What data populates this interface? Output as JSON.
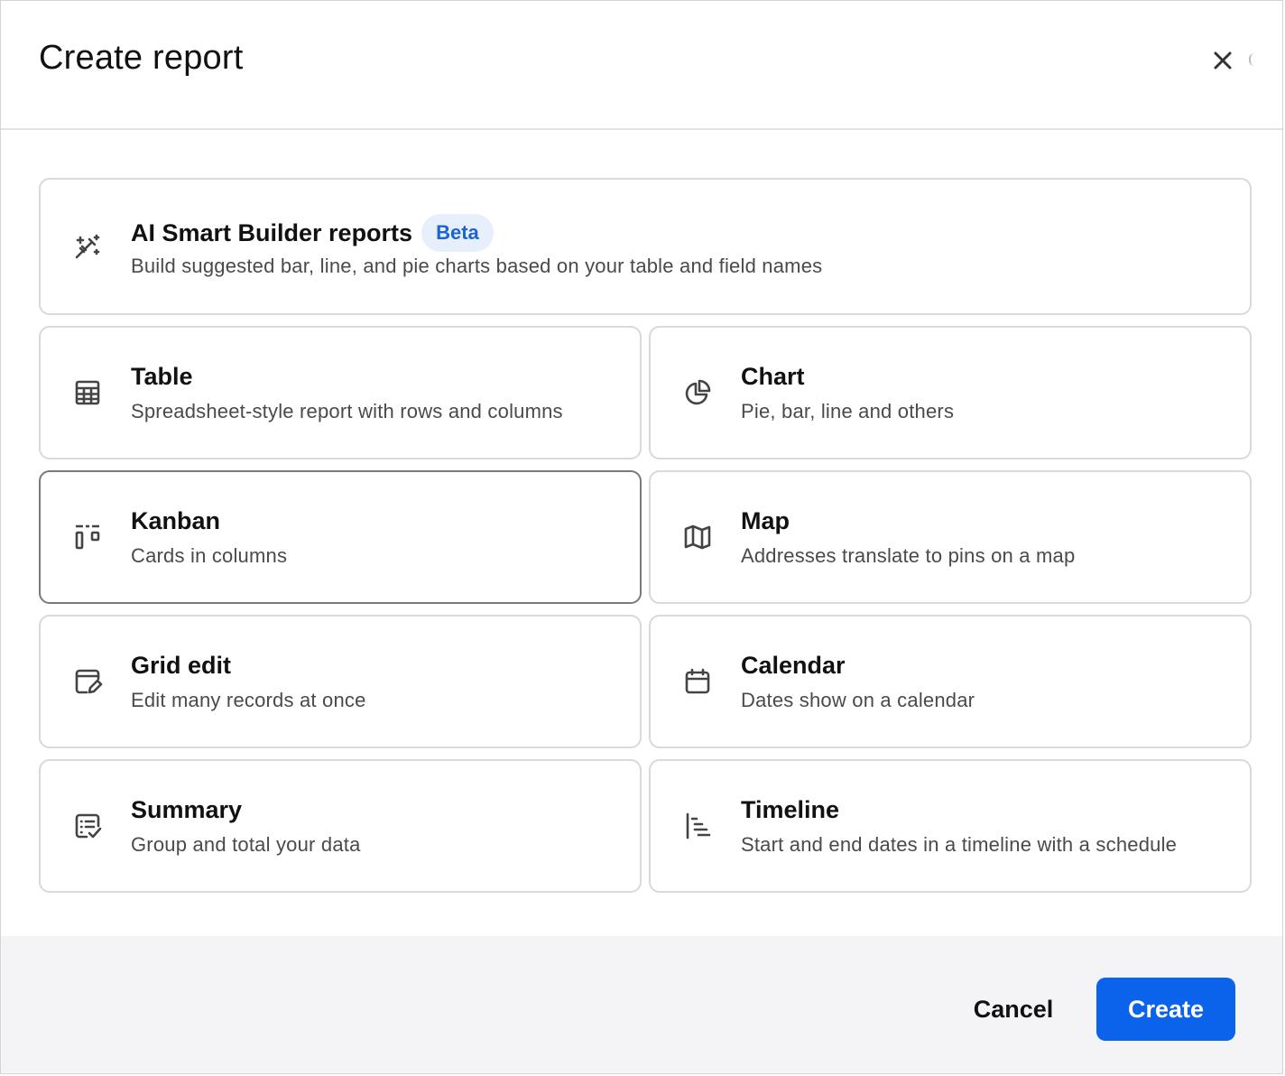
{
  "dialog": {
    "title": "Create report"
  },
  "options": {
    "ai": {
      "name": "AI Smart Builder reports",
      "badge": "Beta",
      "desc": "Build suggested bar, line, and pie charts based on your table and field names",
      "icon": "magic-wand-icon"
    },
    "table": {
      "name": "Table",
      "desc": "Spreadsheet-style report with rows and columns",
      "icon": "table-grid-icon"
    },
    "chart": {
      "name": "Chart",
      "desc": "Pie, bar, line and others",
      "icon": "pie-chart-icon"
    },
    "kanban": {
      "name": "Kanban",
      "desc": "Cards in columns",
      "icon": "kanban-icon",
      "selected": true
    },
    "map": {
      "name": "Map",
      "desc": "Addresses translate to pins on a map",
      "icon": "map-icon"
    },
    "grid_edit": {
      "name": "Grid edit",
      "desc": "Edit many records at once",
      "icon": "grid-edit-icon"
    },
    "calendar": {
      "name": "Calendar",
      "desc": "Dates show on a calendar",
      "icon": "calendar-icon"
    },
    "summary": {
      "name": "Summary",
      "desc": "Group and total your data",
      "icon": "summary-list-icon"
    },
    "timeline": {
      "name": "Timeline",
      "desc": "Start and end dates in a timeline with a schedule",
      "icon": "timeline-icon"
    }
  },
  "footer": {
    "cancel_label": "Cancel",
    "create_label": "Create"
  },
  "colors": {
    "primary": "#0b63ec",
    "badge_bg": "#e8effc",
    "badge_text": "#1a64d6",
    "footer_bg": "#f4f4f6"
  }
}
